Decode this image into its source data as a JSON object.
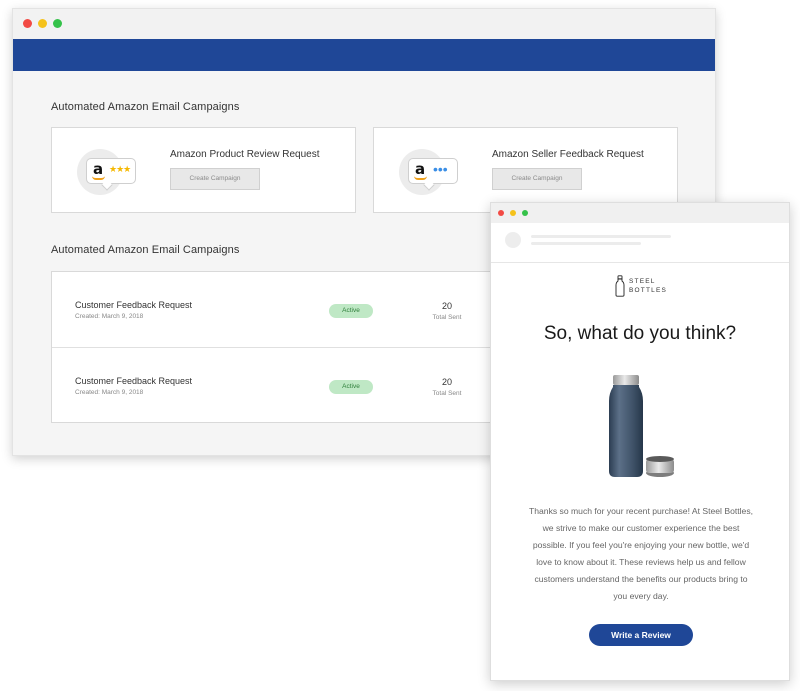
{
  "dashboard": {
    "section1_title": "Automated Amazon Email Campaigns",
    "cards": [
      {
        "title": "Amazon Product Review Request",
        "button": "Create Campaign",
        "icon": "amazon-stars-icon"
      },
      {
        "title": "Amazon Seller Feedback Request",
        "button": "Create Campaign",
        "icon": "amazon-dots-icon"
      }
    ],
    "section2_title": "Automated Amazon Email Campaigns",
    "rows": [
      {
        "title": "Customer Feedback Request",
        "created": "Created: March 9, 2018",
        "status": "Active",
        "count": "20",
        "count_label": "Total Sent"
      },
      {
        "title": "Customer Feedback Request",
        "created": "Created: March 9, 2018",
        "status": "Active",
        "count": "20",
        "count_label": "Total Sent"
      }
    ],
    "colors": {
      "header": "#1f4797",
      "badge_bg": "#bfe8c5",
      "badge_text": "#2f7f3b"
    }
  },
  "email": {
    "brand_line1": "STEEL",
    "brand_line2": "BOTTLES",
    "headline": "So, what do you think?",
    "body": "Thanks so much for your recent purchase! At Steel Bottles, we strive to make our customer experience the best possible. If you feel you're enjoying your new bottle, we'd love to know about it. These reviews help us and fellow customers understand the benefits our products bring to you every day.",
    "cta": "Write a Review",
    "colors": {
      "cta": "#1f4797"
    }
  },
  "amazon": {
    "logo_letter": "a",
    "stars": "★★★",
    "dots": "•••"
  }
}
